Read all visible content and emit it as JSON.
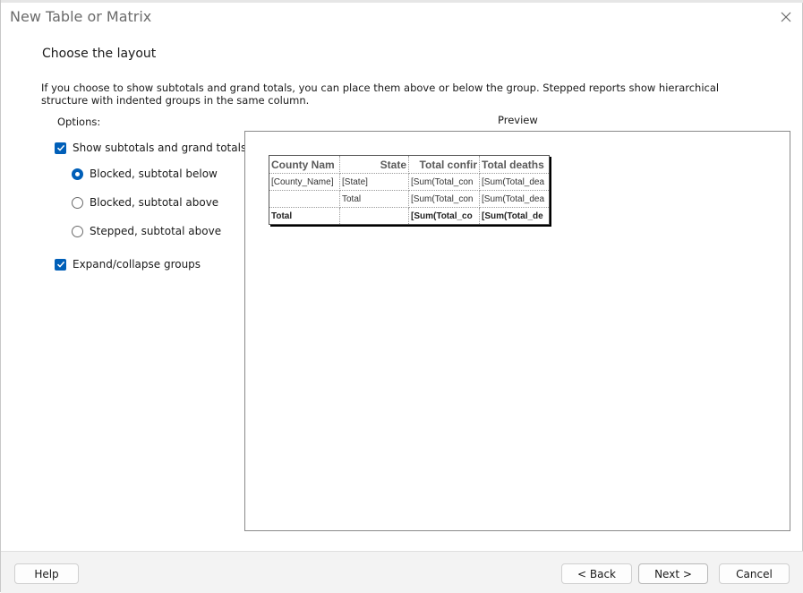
{
  "window": {
    "title": "New Table or Matrix"
  },
  "page": {
    "heading": "Choose the layout",
    "description": "If you choose to show subtotals and grand totals, you can place them above or below the group. Stepped reports show hierarchical structure with indented groups in the same column.",
    "options_label": "Options:",
    "preview_label": "Preview"
  },
  "options": {
    "show_totals": {
      "label": "Show subtotals and grand totals",
      "checked": true
    },
    "blocked_below": {
      "label": "Blocked, subtotal below",
      "selected": true
    },
    "blocked_above": {
      "label": "Blocked, subtotal above",
      "selected": false
    },
    "stepped_above": {
      "label": "Stepped, subtotal above",
      "selected": false
    },
    "expand_collapse": {
      "label": "Expand/collapse groups",
      "checked": true
    }
  },
  "preview_table": {
    "headers": [
      "County Nam",
      "State",
      "Total confir",
      "Total deaths"
    ],
    "rows": [
      [
        "[County_Name]",
        "[State]",
        "[Sum(Total_con",
        "[Sum(Total_dea"
      ],
      [
        "",
        "Total",
        "[Sum(Total_con",
        "[Sum(Total_dea"
      ],
      [
        "Total",
        "",
        "[Sum(Total_co",
        "[Sum(Total_de"
      ]
    ]
  },
  "buttons": {
    "help": "Help",
    "back": "< Back",
    "next": "Next >",
    "cancel": "Cancel"
  },
  "colors": {
    "accent": "#005fb8"
  },
  "icons": {
    "close": "close-icon",
    "check": "checkmark-icon"
  }
}
